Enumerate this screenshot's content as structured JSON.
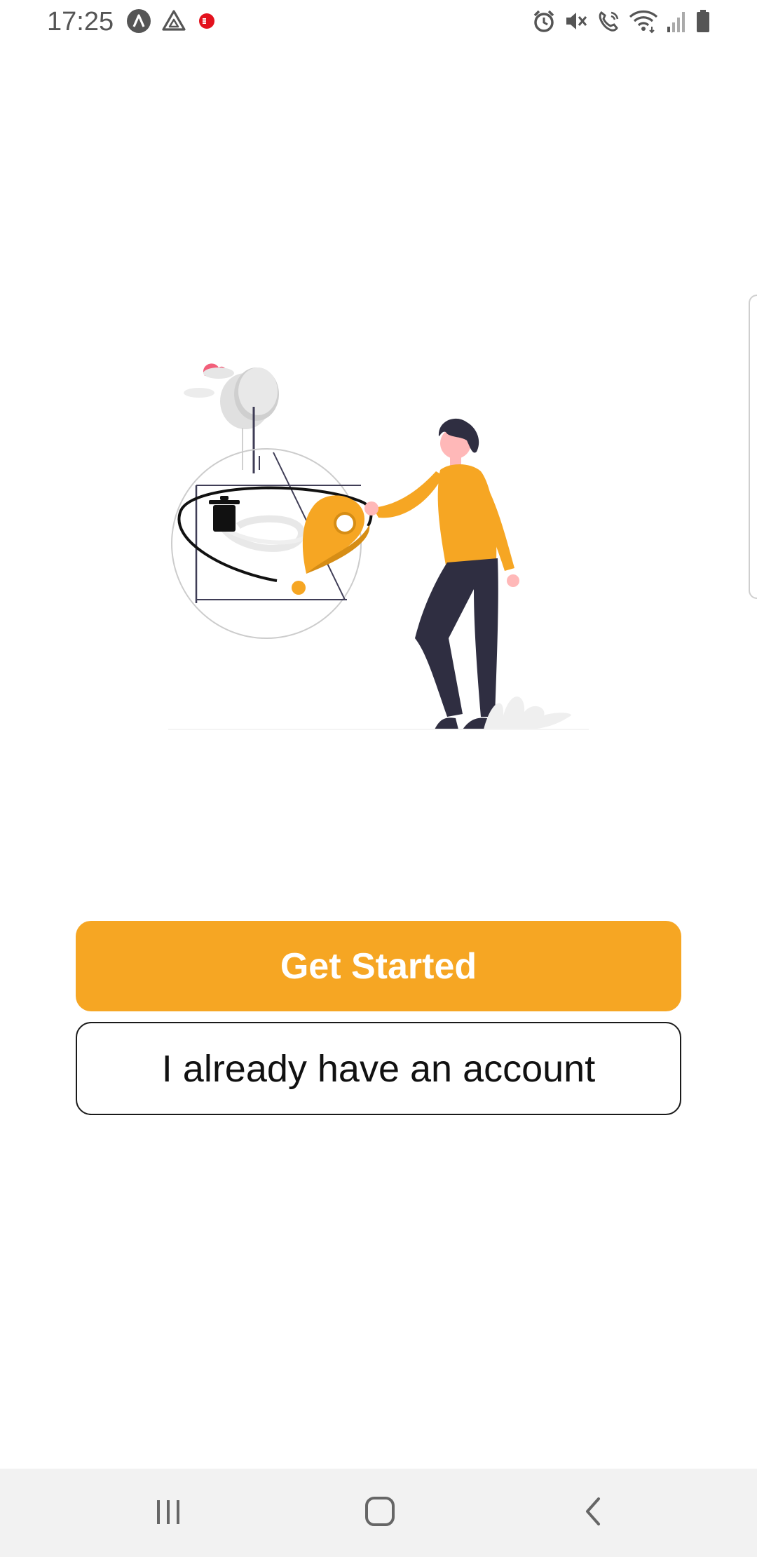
{
  "status_bar": {
    "time": "17:25",
    "left_icons": [
      "app-a-icon",
      "drive-icon",
      "notification-dot-icon"
    ],
    "right_icons": [
      "alarm-icon",
      "mute-icon",
      "wifi-call-icon",
      "wifi-icon",
      "signal-icon",
      "battery-icon"
    ]
  },
  "onboarding": {
    "illustration": "person-placing-map-pin-illustration"
  },
  "actions": {
    "get_started_label": "Get Started",
    "login_label": "I already have an account"
  },
  "navigation": {
    "recents": "recent-apps-icon",
    "home": "home-icon",
    "back": "back-icon"
  },
  "colors": {
    "accent": "#f6a623",
    "dark_text": "#111111",
    "nav_background": "#f2f2f2"
  }
}
